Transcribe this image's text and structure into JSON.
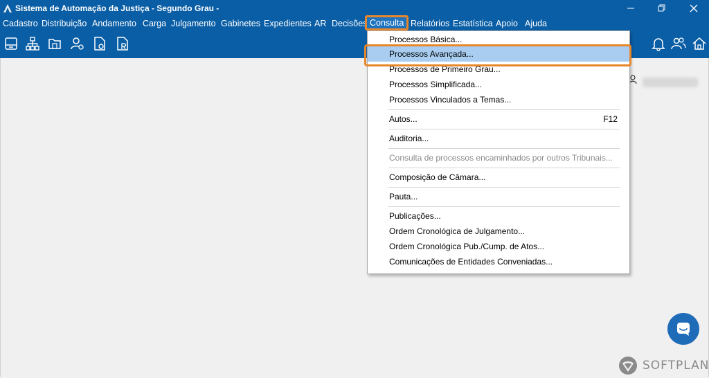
{
  "window": {
    "title": "Sistema de Automação da Justiça - Segundo Grau -",
    "controls": [
      "minimize-icon",
      "restore-icon",
      "close-icon"
    ]
  },
  "menubar": {
    "items": [
      "Cadastro",
      "Distribuição",
      "Andamento",
      "Carga",
      "Julgamento",
      "Gabinetes",
      "Expedientes",
      "AR",
      "Decisões",
      "Consulta",
      "Relatórios",
      "Estatística",
      "Apoio",
      "Ajuda"
    ],
    "active": "Consulta"
  },
  "toolbar": {
    "icons": [
      "inbox-icon",
      "org-chart-icon",
      "folder-icon",
      "user-settings-icon",
      "document-o-icon",
      "document-r-icon"
    ],
    "right_icons": [
      "bell-icon",
      "users-icon",
      "home-icon"
    ]
  },
  "dropdown": {
    "items": [
      {
        "label": "Processos Básica...",
        "shortcut": ""
      },
      {
        "label": "Processos Avançada...",
        "shortcut": "",
        "highlight": true
      },
      {
        "label": "Processos de Primeiro Grau...",
        "shortcut": ""
      },
      {
        "label": "Processos Simplificada...",
        "shortcut": ""
      },
      {
        "label": "Processos Vinculados a Temas...",
        "shortcut": ""
      },
      {
        "label": "Autos...",
        "shortcut": "F12"
      },
      {
        "label": "Auditoria...",
        "shortcut": ""
      },
      {
        "label": "Consulta de processos encaminhados por outros Tribunais...",
        "shortcut": "",
        "disabled": true
      },
      {
        "label": "Composição de Câmara...",
        "shortcut": ""
      },
      {
        "label": "Pauta...",
        "shortcut": ""
      },
      {
        "label": "Publicações...",
        "shortcut": ""
      },
      {
        "label": "Ordem Cronológica de Julgamento...",
        "shortcut": ""
      },
      {
        "label": "Ordem Cronológica Pub./Cump. de Atos...",
        "shortcut": ""
      },
      {
        "label": "Comunicações de Entidades Conveniadas...",
        "shortcut": ""
      }
    ]
  },
  "brand": {
    "name": "SOFTPLAN"
  },
  "colors": {
    "titlebar": "#0a5ea6",
    "highlight": "#a8cdf0",
    "accent_frame": "#e8862a"
  }
}
